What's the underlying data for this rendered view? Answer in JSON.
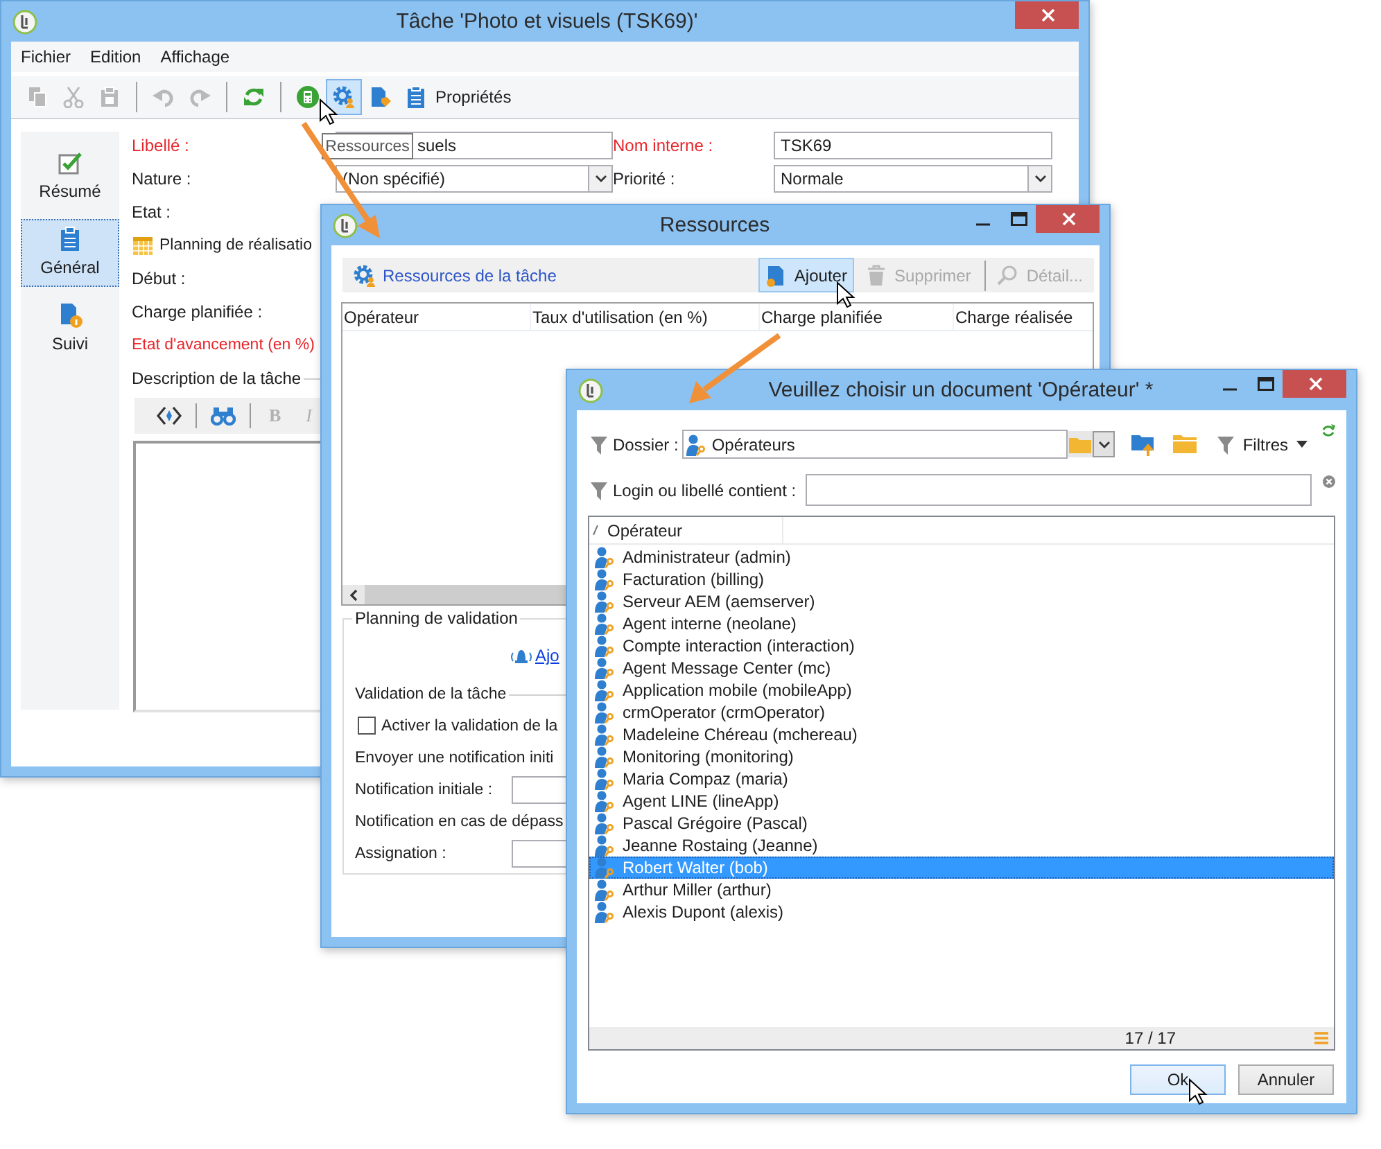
{
  "task_window": {
    "title": "Tâche 'Photo et visuels (TSK69)'",
    "menu": [
      "Fichier",
      "Edition",
      "Affichage"
    ],
    "toolbar": [
      {
        "kind": "copy",
        "disabled": true,
        "highlighted": false
      },
      {
        "kind": "cut",
        "disabled": true,
        "highlighted": false
      },
      {
        "kind": "paste",
        "disabled": true,
        "highlighted": false
      },
      {
        "kind": "separator"
      },
      {
        "kind": "undo",
        "disabled": true,
        "highlighted": false
      },
      {
        "kind": "redo",
        "disabled": true,
        "highlighted": false
      },
      {
        "kind": "separator"
      },
      {
        "kind": "refresh",
        "disabled": false,
        "highlighted": false
      },
      {
        "kind": "separator"
      },
      {
        "kind": "calculator",
        "disabled": false,
        "highlighted": false
      },
      {
        "kind": "resources",
        "disabled": false,
        "highlighted": true
      },
      {
        "kind": "tag",
        "disabled": false,
        "highlighted": false
      },
      {
        "kind": "properties",
        "label": "Propriétés",
        "disabled": false,
        "highlighted": false
      }
    ],
    "tooltip": "Ressources",
    "sidebar": [
      {
        "label": "Résumé",
        "selected": false
      },
      {
        "label": "Général",
        "selected": true
      },
      {
        "label": "Suivi",
        "selected": false
      }
    ],
    "fields": [
      {
        "label": "Libellé :",
        "required": true,
        "kind": "text",
        "value": "suels"
      },
      {
        "label": "Nom interne :",
        "required": true,
        "kind": "text",
        "value": "TSK69"
      },
      {
        "label": "Nature :",
        "required": false,
        "kind": "dropdown",
        "value": "(Non spécifié)"
      },
      {
        "label": "Priorité :",
        "required": false,
        "kind": "dropdown",
        "value": "Normale"
      }
    ],
    "labels": [
      {
        "label": "Etat :",
        "required": false,
        "kind": "plain"
      },
      {
        "label": "Planning de réalisatio",
        "required": false,
        "kind": "section"
      },
      {
        "label": "Début :",
        "required": false,
        "kind": "plain"
      },
      {
        "label": "Charge planifiée :",
        "required": false,
        "kind": "plain"
      },
      {
        "label": "Etat d'avancement (en %)",
        "required": true,
        "kind": "plain"
      }
    ],
    "description": {
      "title": "Description de la tâche",
      "format_buttons": [
        {
          "label": "B",
          "disabled": true
        },
        {
          "label": "I",
          "disabled": true
        }
      ]
    }
  },
  "resources_window": {
    "title": "Ressources",
    "header_link": "Ressources de la tâche",
    "actions": [
      {
        "label": "Ajouter",
        "disabled": false,
        "highlighted": true
      },
      {
        "label": "Supprimer",
        "disabled": true,
        "highlighted": false
      },
      {
        "label": "Détail...",
        "disabled": true,
        "highlighted": false
      }
    ],
    "columns": [
      "Opérateur",
      "Taux d'utilisation (en %)",
      "Charge planifiée",
      "Charge réalisée"
    ],
    "validation": {
      "title": "Planning de validation",
      "link": "Ajo",
      "subtitle": "Validation de la tâche",
      "rows": [
        {
          "kind": "checkbox",
          "label": "Activer la validation de la",
          "checked": false
        },
        {
          "kind": "text",
          "label": "Envoyer une notification initi"
        },
        {
          "kind": "field",
          "label": "Notification initiale :"
        },
        {
          "kind": "text",
          "label": "Notification en cas de dépass"
        },
        {
          "kind": "field",
          "label": "Assignation :"
        }
      ]
    }
  },
  "operator_dialog": {
    "title": "Veuillez choisir un document 'Opérateur' *",
    "folder_label": "Dossier :",
    "folder_value": "Opérateurs",
    "filters": "Filtres",
    "search_label": "Login ou libellé contient :",
    "column": "Opérateur",
    "operators": [
      {
        "name": "Administrateur (admin)",
        "selected": false
      },
      {
        "name": "Facturation (billing)",
        "selected": false
      },
      {
        "name": "Serveur AEM (aemserver)",
        "selected": false
      },
      {
        "name": "Agent interne (neolane)",
        "selected": false
      },
      {
        "name": "Compte interaction (interaction)",
        "selected": false
      },
      {
        "name": "Agent Message Center (mc)",
        "selected": false
      },
      {
        "name": "Application mobile (mobileApp)",
        "selected": false
      },
      {
        "name": "crmOperator (crmOperator)",
        "selected": false
      },
      {
        "name": "Madeleine Chéreau (mchereau)",
        "selected": false
      },
      {
        "name": "Monitoring (monitoring)",
        "selected": false
      },
      {
        "name": "Maria Compaz (maria)",
        "selected": false
      },
      {
        "name": "Agent LINE (lineApp)",
        "selected": false
      },
      {
        "name": "Pascal Grégoire (Pascal)",
        "selected": false
      },
      {
        "name": "Jeanne Rostaing (Jeanne)",
        "selected": false
      },
      {
        "name": "Robert Walter (bob)",
        "selected": true
      },
      {
        "name": "Arthur Miller (arthur)",
        "selected": false
      },
      {
        "name": "Alexis Dupont (alexis)",
        "selected": false
      }
    ],
    "count": "17 / 17",
    "buttons": [
      {
        "label": "Ok",
        "default": true
      },
      {
        "label": "Annuler",
        "default": false
      }
    ]
  }
}
